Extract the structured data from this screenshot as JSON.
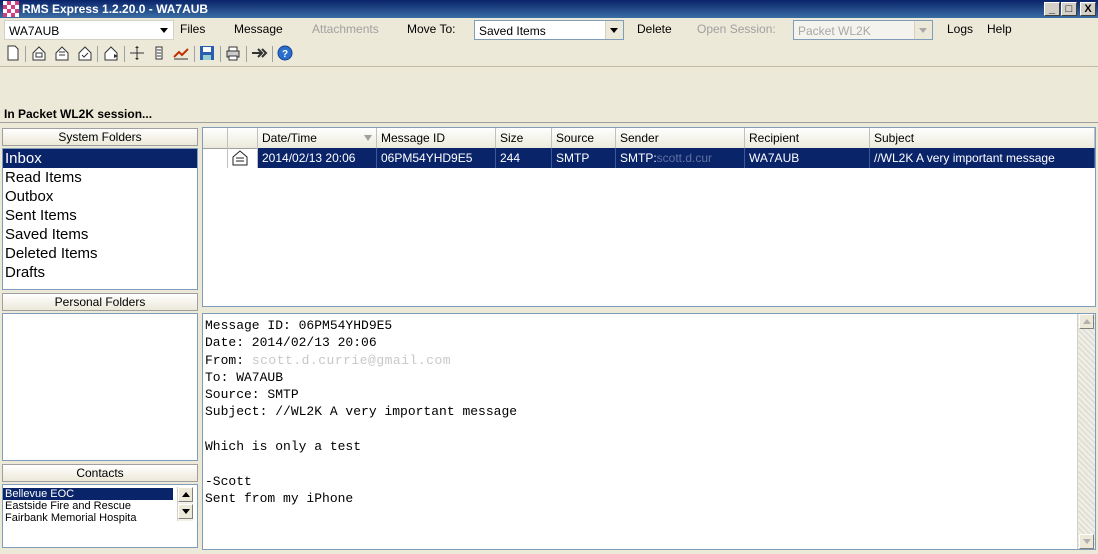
{
  "window": {
    "title": "RMS Express 1.2.20.0 - WA7AUB",
    "minimize": "_",
    "maximize": "□",
    "close": "X"
  },
  "menubar": {
    "callsign": "WA7AUB",
    "files": "Files",
    "message": "Message",
    "attachments": "Attachments",
    "move_to": "Move To:",
    "move_to_value": "Saved Items",
    "delete": "Delete",
    "open_session": "Open Session:",
    "session_value": "Packet WL2K",
    "logs": "Logs",
    "help": "Help"
  },
  "toolbar": {
    "icons": [
      "new-message-icon",
      "post-outbox-icon",
      "read-icon",
      "mark-icon",
      "print-preview-icon",
      "move-icon",
      "archive-icon",
      "forward-icon",
      "save-icon",
      "print-icon",
      "session-icon",
      "help-icon"
    ]
  },
  "status": "In Packet WL2K session...",
  "system_folders": {
    "header": "System Folders",
    "items": [
      "Inbox",
      "Read Items",
      "Outbox",
      "Sent Items",
      "Saved Items",
      "Deleted Items",
      "Drafts"
    ]
  },
  "personal_folders": {
    "header": "Personal Folders"
  },
  "contacts": {
    "header": "Contacts",
    "items": [
      "Bellevue EOC",
      "Eastside Fire and Rescue",
      "Fairbank Memorial Hospita"
    ]
  },
  "grid": {
    "columns": [
      "Date/Time",
      "Message ID",
      "Size",
      "Source",
      "Sender",
      "Recipient",
      "Subject"
    ],
    "rows": [
      {
        "datetime": "2014/02/13 20:06",
        "message_id": "06PM54YHD9E5",
        "size": "244",
        "source": "SMTP",
        "sender": "SMTP:",
        "sender_redacted": "scott.d.cur",
        "recipient": "WA7AUB",
        "subject": "//WL2K A very important message"
      }
    ]
  },
  "preview": {
    "l1": "Message ID: 06PM54YHD9E5",
    "l2": "Date: 2014/02/13 20:06",
    "l3_label": "From: ",
    "l3_redacted": "scott.d.currie@gmail.com",
    "l4": "To: WA7AUB",
    "l5": "Source: SMTP",
    "l6": "Subject: //WL2K A very important message",
    "l8": "Which is only a test",
    "l10": "-Scott",
    "l11": "Sent from my iPhone"
  },
  "colors": {
    "selection": "#0a246a",
    "titlebar": "#0a246a",
    "toolbar": "#ece9d8"
  }
}
